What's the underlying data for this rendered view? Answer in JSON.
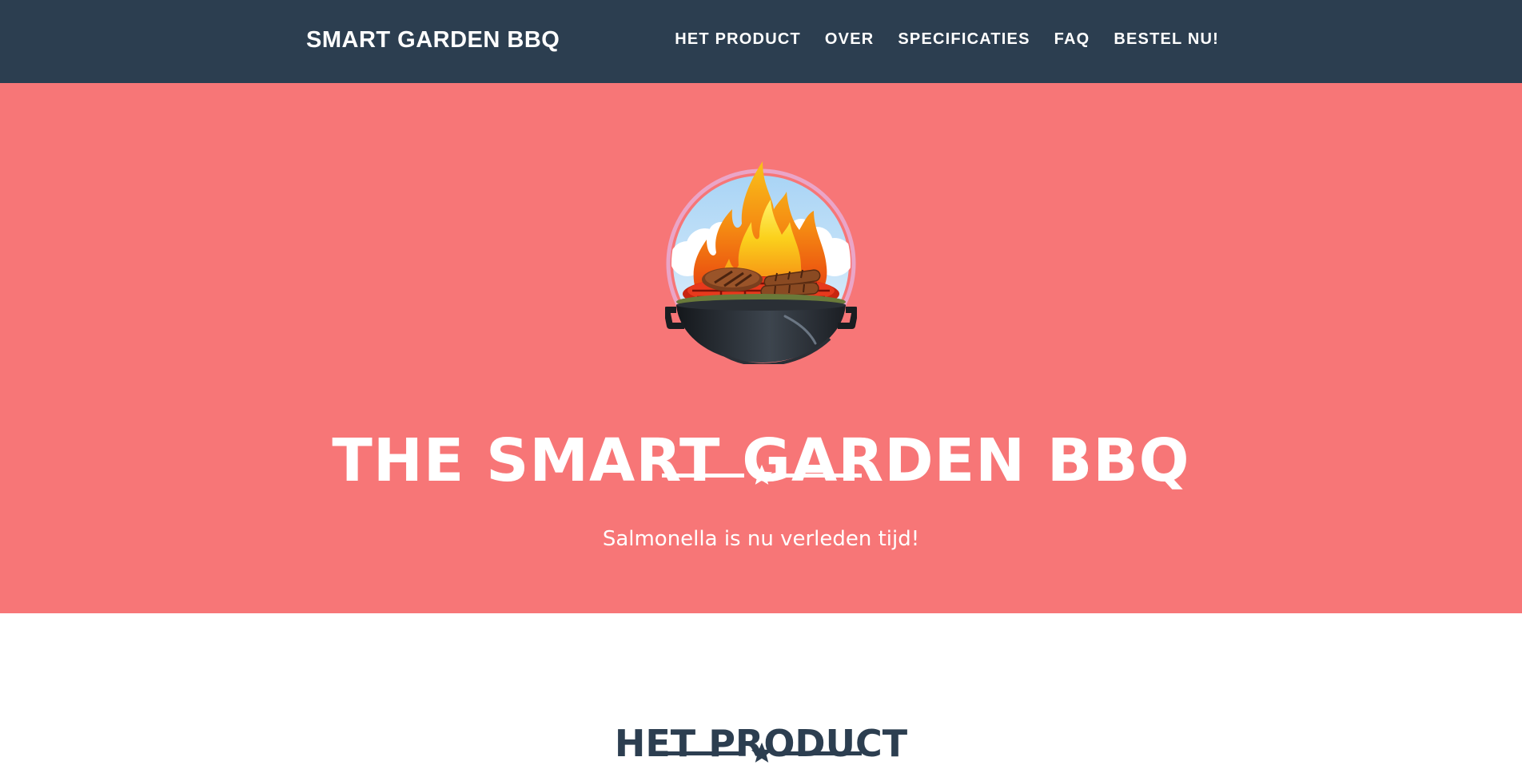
{
  "navbar": {
    "brand": "SMART GARDEN BBQ",
    "links": [
      "HET PRODUCT",
      "OVER",
      "SPECIFICATIES",
      "FAQ",
      "BESTEL NU!"
    ]
  },
  "hero": {
    "logo_icon": "bbq-grill-flames-icon",
    "title": "THE SMART GARDEN BBQ",
    "divider_icon": "star-icon",
    "subtitle": "Salmonella is nu verleden tijd!"
  },
  "section": {
    "title": "HET PRODUCT",
    "divider_icon": "star-icon"
  },
  "colors": {
    "navbar_bg": "#2c3e50",
    "hero_bg": "#f77677",
    "text_light": "#ffffff",
    "text_dark": "#2c3e50"
  }
}
